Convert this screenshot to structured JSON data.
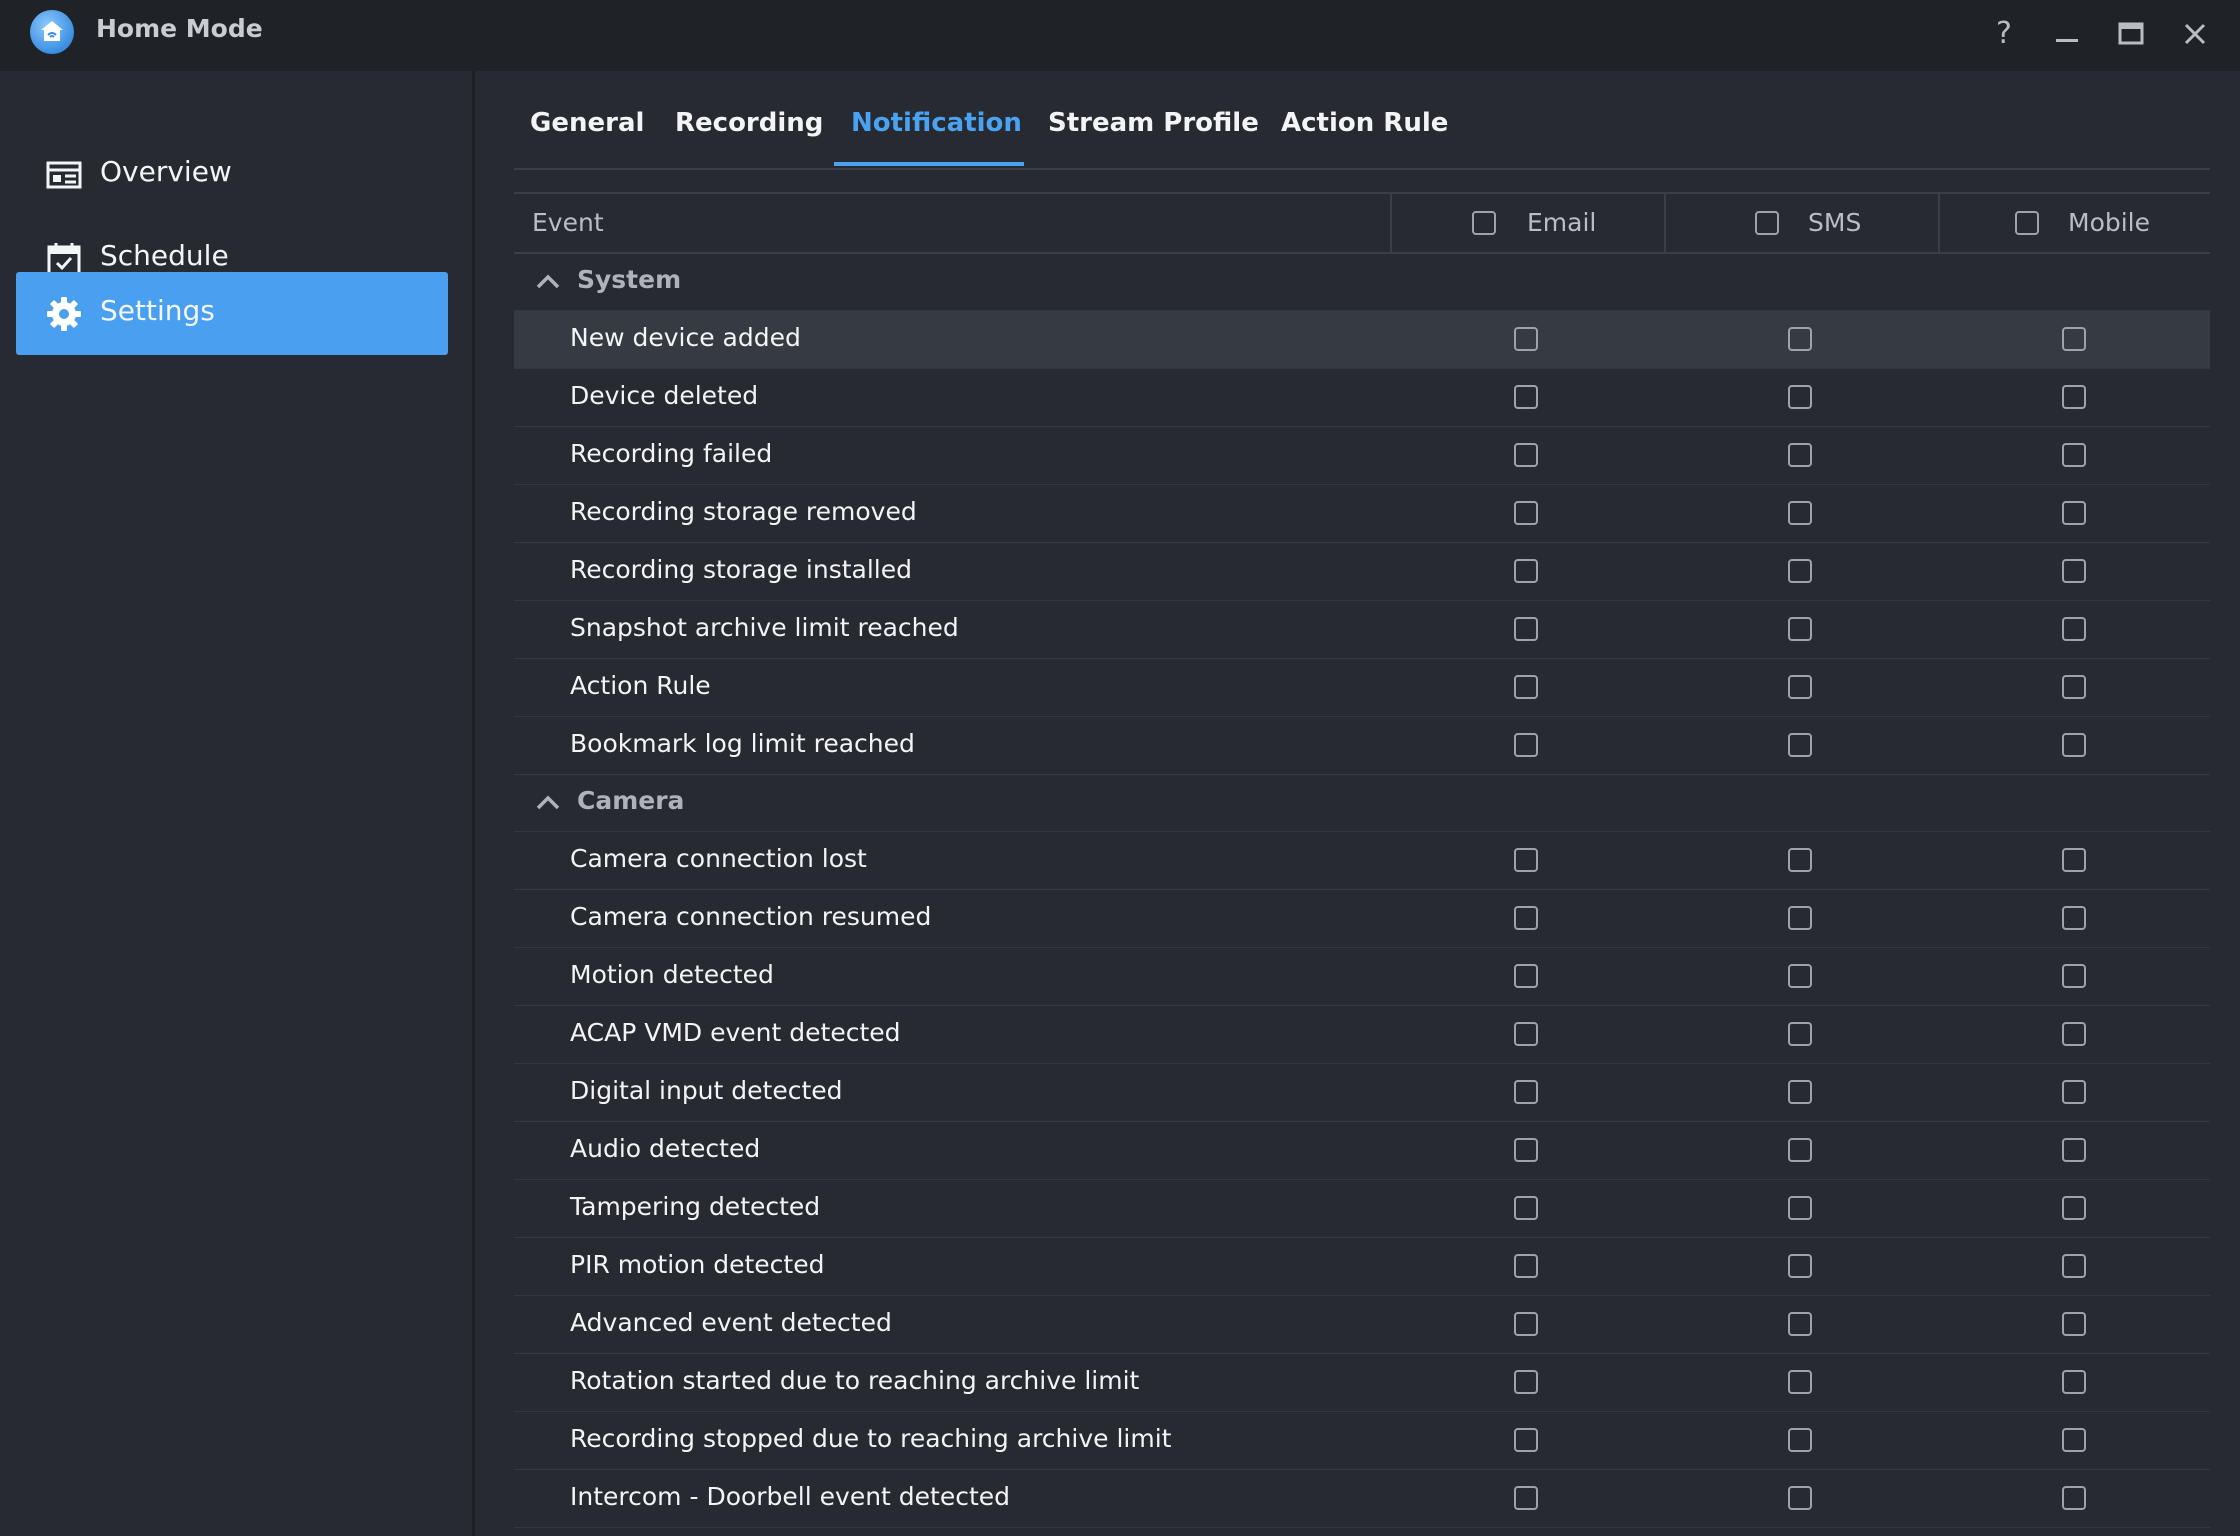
{
  "window": {
    "title": "Home Mode",
    "controls": {
      "help": "?"
    }
  },
  "sidebar": {
    "items": [
      {
        "label": "Overview",
        "icon": "overview-icon",
        "active": false
      },
      {
        "label": "Schedule",
        "icon": "calendar-check-icon",
        "active": false
      },
      {
        "label": "Settings",
        "icon": "gear-icon",
        "active": true
      }
    ]
  },
  "tabs": [
    {
      "label": "General",
      "active": false
    },
    {
      "label": "Recording",
      "active": false
    },
    {
      "label": "Notification",
      "active": true
    },
    {
      "label": "Stream Profile",
      "active": false
    },
    {
      "label": "Action Rule",
      "active": false
    }
  ],
  "table": {
    "columns": {
      "event": "Event",
      "email": "Email",
      "sms": "SMS",
      "mobile": "Mobile"
    },
    "groups": [
      {
        "label": "System",
        "expanded": true,
        "rows": [
          "New device added",
          "Device deleted",
          "Recording failed",
          "Recording storage removed",
          "Recording storage installed",
          "Snapshot archive limit reached",
          "Action Rule",
          "Bookmark log limit reached"
        ]
      },
      {
        "label": "Camera",
        "expanded": true,
        "rows": [
          "Camera connection lost",
          "Camera connection resumed",
          "Motion detected",
          "ACAP VMD event detected",
          "Digital input detected",
          "Audio detected",
          "Tampering detected",
          "PIR motion detected",
          "Advanced event detected",
          "Rotation started due to reaching archive limit",
          "Recording stopped due to reaching archive limit",
          "Intercom - Doorbell event detected"
        ]
      }
    ]
  },
  "colors": {
    "accent": "#4aa3f2",
    "background": "#272a30",
    "titlebar": "#1f2226"
  }
}
